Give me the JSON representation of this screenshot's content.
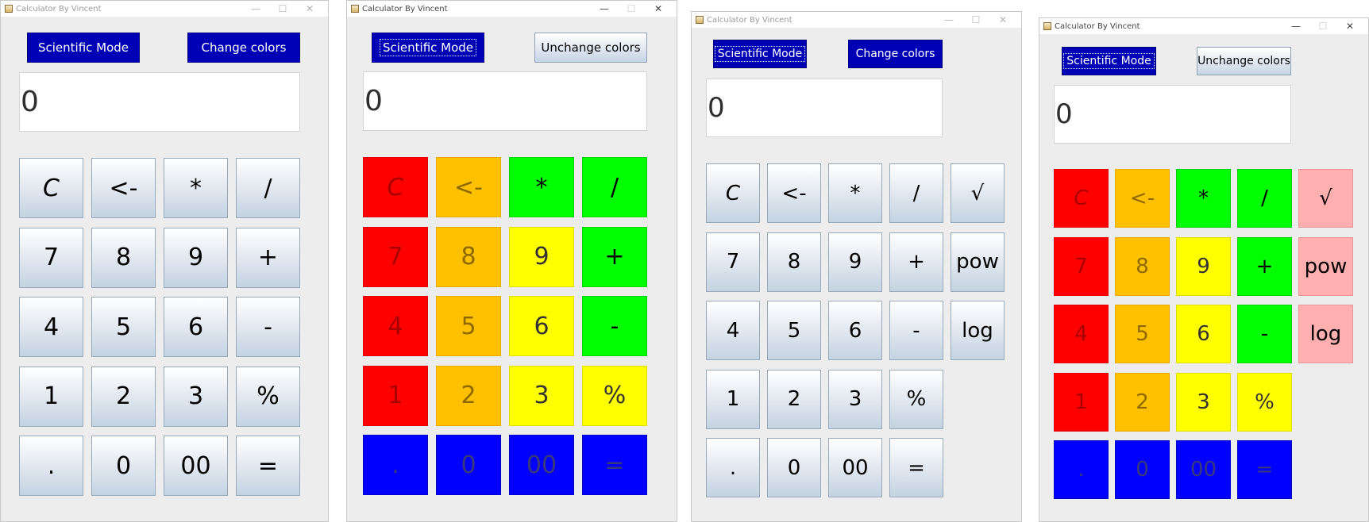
{
  "app": {
    "title": "Calculator By Vincent",
    "controls": {
      "minimize": "—",
      "maximize": "☐",
      "close": "✕"
    },
    "icon": "java-cup-icon"
  },
  "windows": [
    {
      "id": "w1",
      "top_left_button": "Scientific Mode",
      "top_right_button": "Change colors",
      "display": "0"
    },
    {
      "id": "w2",
      "top_left_button": "Scientific Mode",
      "top_right_button": "Unchange colors",
      "display": "0"
    },
    {
      "id": "w3",
      "top_left_button": "Scientific Mode",
      "top_right_button": "Change colors",
      "display": "0"
    },
    {
      "id": "w4",
      "top_left_button": "Scientific Mode",
      "top_right_button": "Unchange colors",
      "display": "0"
    }
  ],
  "keys": {
    "rows": [
      [
        "C",
        "<-",
        "*",
        "/"
      ],
      [
        "7",
        "8",
        "9",
        "+"
      ],
      [
        "4",
        "5",
        "6",
        "-"
      ],
      [
        "1",
        "2",
        "3",
        "%"
      ],
      [
        ".",
        "0",
        "00",
        "="
      ]
    ],
    "scientific": [
      "√",
      "pow",
      "log"
    ]
  },
  "colors": {
    "window_bg": "#ededed",
    "blue_button": "#0000b4",
    "red": "#ff0000",
    "orange": "#ffc000",
    "yellow": "#ffff00",
    "green": "#00ff00",
    "blue": "#0000ff",
    "pink": "#ffafaf"
  }
}
